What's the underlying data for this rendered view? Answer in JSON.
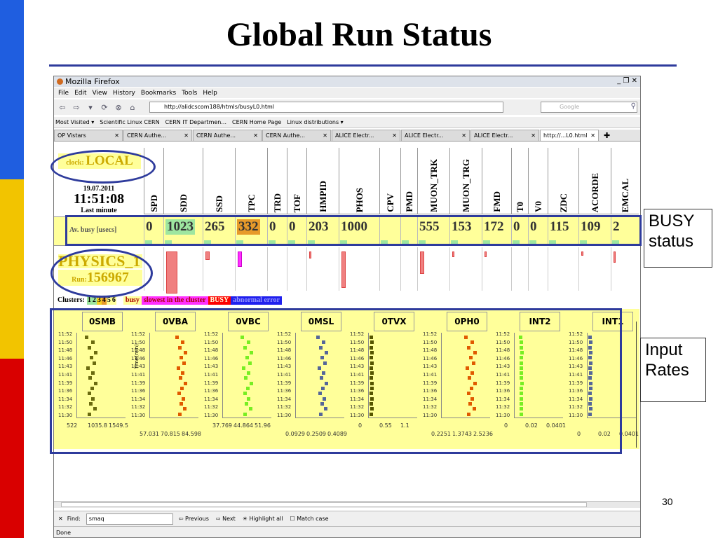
{
  "slide": {
    "title": "Global Run Status",
    "page_number": "30",
    "accent": "#2e3b9c",
    "side_colors": [
      "#1f5ee0",
      "#f2c400",
      "#d90000"
    ]
  },
  "callouts": {
    "busy": "BUSY\nstatus",
    "rates": "Input\nRates"
  },
  "window": {
    "title": "Mozilla Firefox",
    "winbtns": "_ ❐ ✕",
    "menu": [
      "File",
      "Edit",
      "View",
      "History",
      "Bookmarks",
      "Tools",
      "Help"
    ],
    "url": "http://alidcscom188/htmls/busyL0.html",
    "search_placeholder": "Google",
    "bookmarks": [
      "Most Visited ▾",
      "Scientific Linux CERN",
      "CERN IT Departmen...",
      "CERN Home Page",
      "Linux distributions ▾"
    ],
    "tabs": [
      "OP Vistars",
      "CERN Authe...",
      "CERN Authe...",
      "CERN Authe...",
      "ALICE Electr...",
      "ALICE Electr...",
      "ALICE Electr...",
      "http://...L0.html"
    ],
    "find": {
      "label": "Find:",
      "value": "smaq",
      "previous": "Previous",
      "next": "Next",
      "highlight": "Highlight all",
      "match": "Match case"
    },
    "status": "Done"
  },
  "page": {
    "clock_prefix": "clock:",
    "clock_value": "LOCAL",
    "date": "19.07.2011",
    "time": "11:51:08",
    "last_minute": "Last minute",
    "av_busy_label": "Av. busy [usecs]",
    "run_mode": "PHYSICS_1",
    "run_prefix": "Run:",
    "run_number": "156967",
    "detectors": [
      {
        "name": "SPD",
        "busy": "0"
      },
      {
        "name": "SDD",
        "busy": "1023"
      },
      {
        "name": "SSD",
        "busy": "265"
      },
      {
        "name": "TPC",
        "busy": "332"
      },
      {
        "name": "TRD",
        "busy": "0"
      },
      {
        "name": "TOF",
        "busy": "0"
      },
      {
        "name": "HMPID",
        "busy": "203"
      },
      {
        "name": "PHOS",
        "busy": "1000"
      },
      {
        "name": "CPV",
        "busy": ""
      },
      {
        "name": "PMD",
        "busy": ""
      },
      {
        "name": "MUON_TRK",
        "busy": "555"
      },
      {
        "name": "MUON_TRG",
        "busy": "153"
      },
      {
        "name": "FMD",
        "busy": "172"
      },
      {
        "name": "T0",
        "busy": "0"
      },
      {
        "name": "V0",
        "busy": "0"
      },
      {
        "name": "ZDC",
        "busy": "115"
      },
      {
        "name": "ACORDE",
        "busy": "109"
      },
      {
        "name": "EMCAL",
        "busy": "2"
      }
    ],
    "legend": {
      "clusters": "Clusters:",
      "numbers": [
        "1",
        "2",
        "3",
        "4",
        "5",
        "6"
      ],
      "busy": "busy",
      "slowest": "slowest in the cluster",
      "BUSY": "BUSY",
      "error": "abnormal error"
    },
    "rate_panels": [
      {
        "name": "0SMB",
        "x_ticks": [
          "522",
          "1035.8",
          "1549.5"
        ],
        "color": "#6b6b10"
      },
      {
        "name": "0VBA",
        "x_ticks": [
          "57.031",
          "70.815",
          "84.598"
        ],
        "color": "#e05a00"
      },
      {
        "name": "0VBC",
        "x_ticks": [
          "37.769",
          "44.864",
          "51.96"
        ],
        "color": "#77ee22"
      },
      {
        "name": "0MSL",
        "x_ticks": [
          "0.0929",
          "0.2509",
          "0.4089"
        ],
        "color": "#556699"
      },
      {
        "name": "0TVX",
        "x_ticks": [
          "0",
          "0.55",
          "1.1"
        ],
        "color": "#555500"
      },
      {
        "name": "0PH0",
        "x_ticks": [
          "0.2251",
          "1.3743",
          "2.5236"
        ],
        "color": "#e05a00"
      },
      {
        "name": "INT2",
        "x_ticks": [
          "0",
          "0.02",
          "0.0401"
        ],
        "color": "#77ee22"
      },
      {
        "name": "INT1",
        "x_ticks": [
          "0",
          "0.02",
          "0.0401"
        ],
        "color": "#556699"
      }
    ],
    "y_ticks": [
      "11:52",
      "11:50",
      "11:48",
      "11:46",
      "11:43",
      "11:41",
      "11:39",
      "11:36",
      "11:34",
      "11:32",
      "11:30"
    ],
    "ylabel_time": "Time(min)"
  }
}
